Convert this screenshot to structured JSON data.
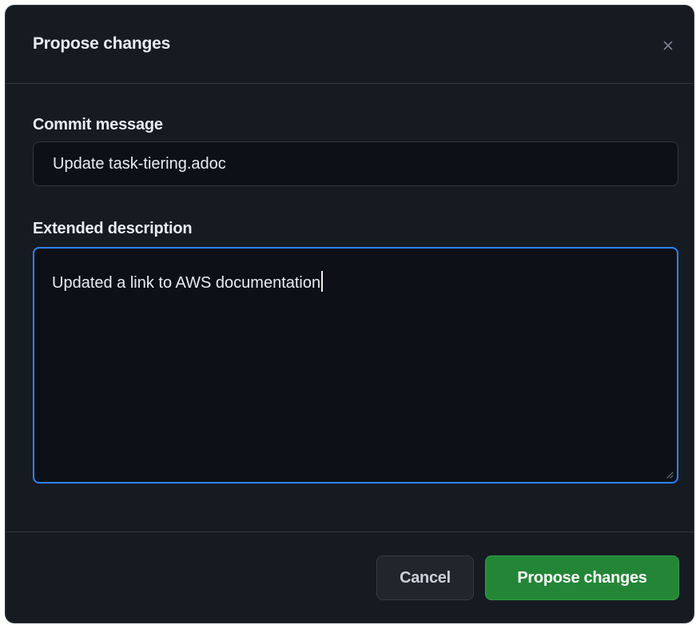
{
  "dialog": {
    "title": "Propose changes",
    "close_icon": "close-icon"
  },
  "commit": {
    "label": "Commit message",
    "value": "Update task-tiering.adoc"
  },
  "description": {
    "label": "Extended description",
    "value": "Updated a link to AWS documentation",
    "focused": true
  },
  "footer": {
    "cancel_label": "Cancel",
    "submit_label": "Propose changes"
  },
  "colors": {
    "background": "#161b22",
    "input_background": "#0d1117",
    "border": "#30363d",
    "focus_ring": "#2f81f7",
    "primary_button": "#238636",
    "text": "#e6edf3"
  }
}
